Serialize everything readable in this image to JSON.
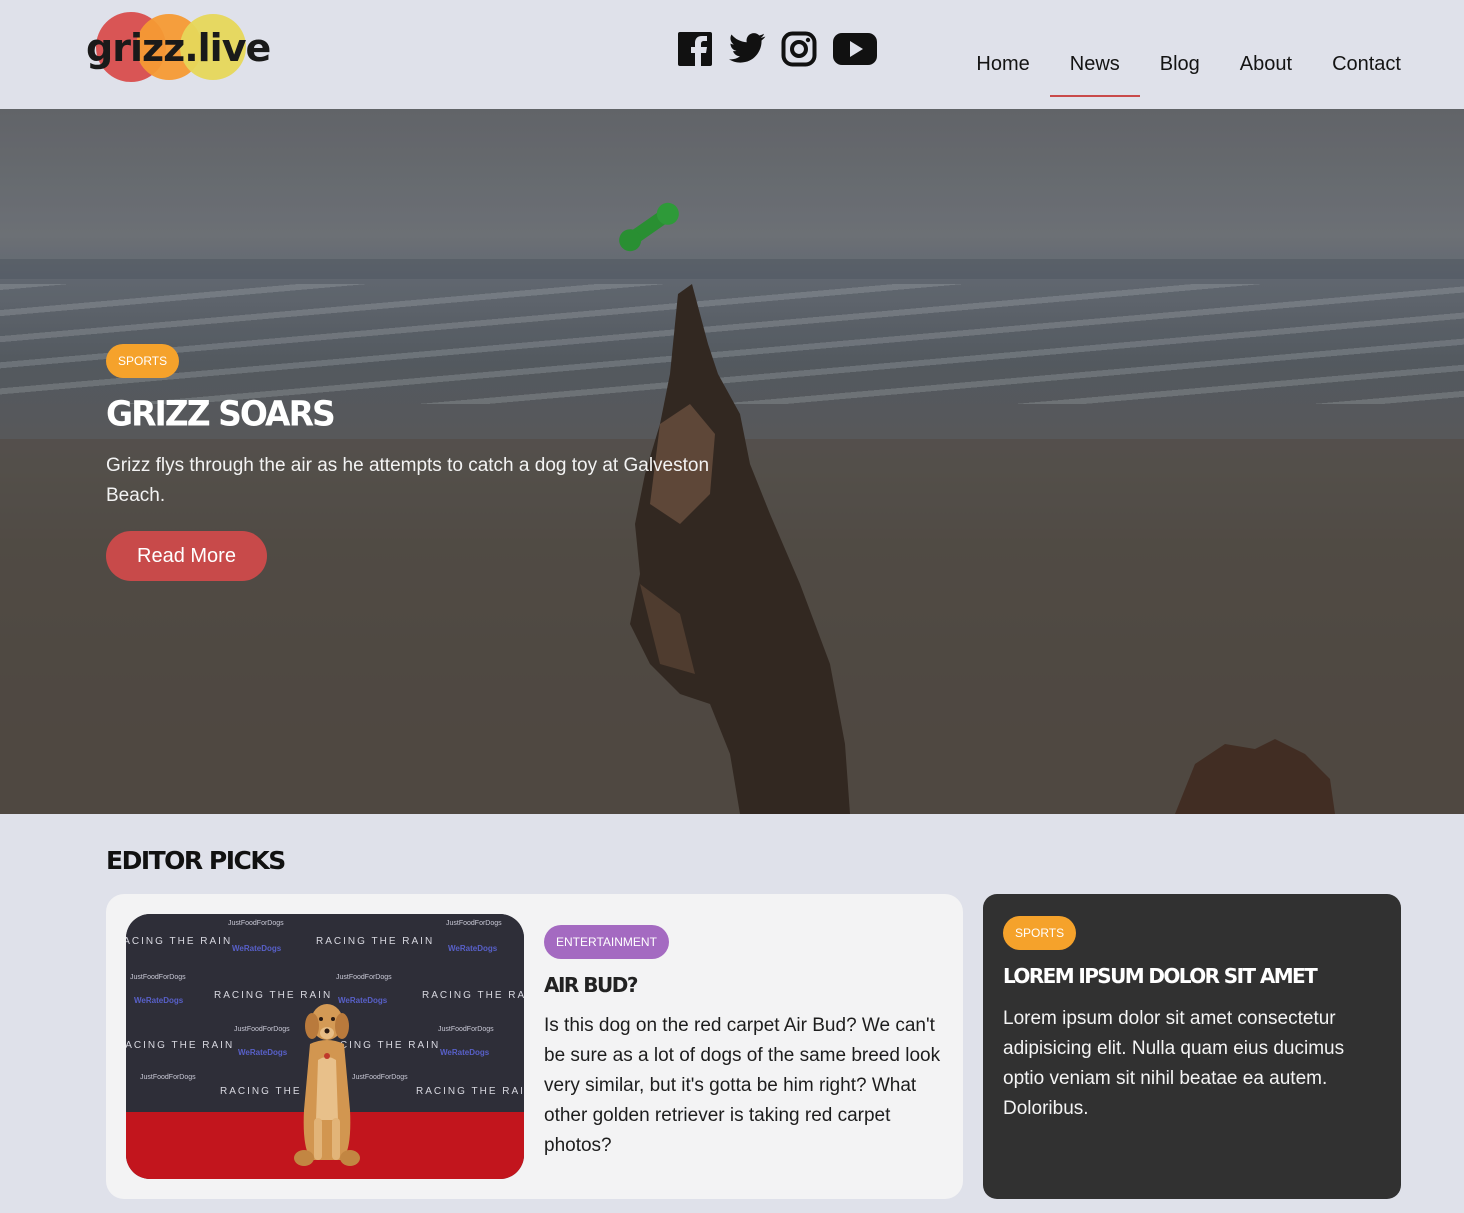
{
  "header": {
    "logo_text": "grizz.live",
    "social": [
      {
        "icon": "facebook-icon"
      },
      {
        "icon": "twitter-icon"
      },
      {
        "icon": "instagram-icon"
      },
      {
        "icon": "youtube-icon"
      }
    ],
    "nav": [
      {
        "label": "Home",
        "active": false
      },
      {
        "label": "News",
        "active": true
      },
      {
        "label": "Blog",
        "active": false
      },
      {
        "label": "About",
        "active": false
      },
      {
        "label": "Contact",
        "active": false
      }
    ],
    "accent_color": "#c94a4a"
  },
  "hero": {
    "category": "SPORTS",
    "title": "GRIZZ SOARS",
    "description": "Grizz flys through the air as he attempts to catch a dog toy at Galveston Beach.",
    "button_label": "Read More"
  },
  "editor_picks": {
    "heading": "EDITOR PICKS",
    "featured": {
      "category": "ENTERTAINMENT",
      "title": "AIR BUD?",
      "description": "Is this dog on the red carpet Air Bud? We can't be sure as a lot of dogs of the same breed look very similar, but it's gotta be him right? What other golden retriever is taking red carpet photos?",
      "photo_wall_text": {
        "racing": "RACING THE RAIN",
        "brand": "JustFoodForDogs",
        "rated": "WeRateDogs"
      }
    },
    "secondary": {
      "category": "SPORTS",
      "title": "LOREM IPSUM DOLOR SIT AMET",
      "description": "Lorem ipsum dolor sit amet consectetur adipisicing elit. Nulla quam eius ducimus optio veniam sit nihil beatae ea autem. Doloribus."
    }
  },
  "colors": {
    "sports_badge": "#f5a22b",
    "entertainment_badge": "#a46ac1",
    "button": "#c84a4a",
    "dark_card": "#313131"
  }
}
